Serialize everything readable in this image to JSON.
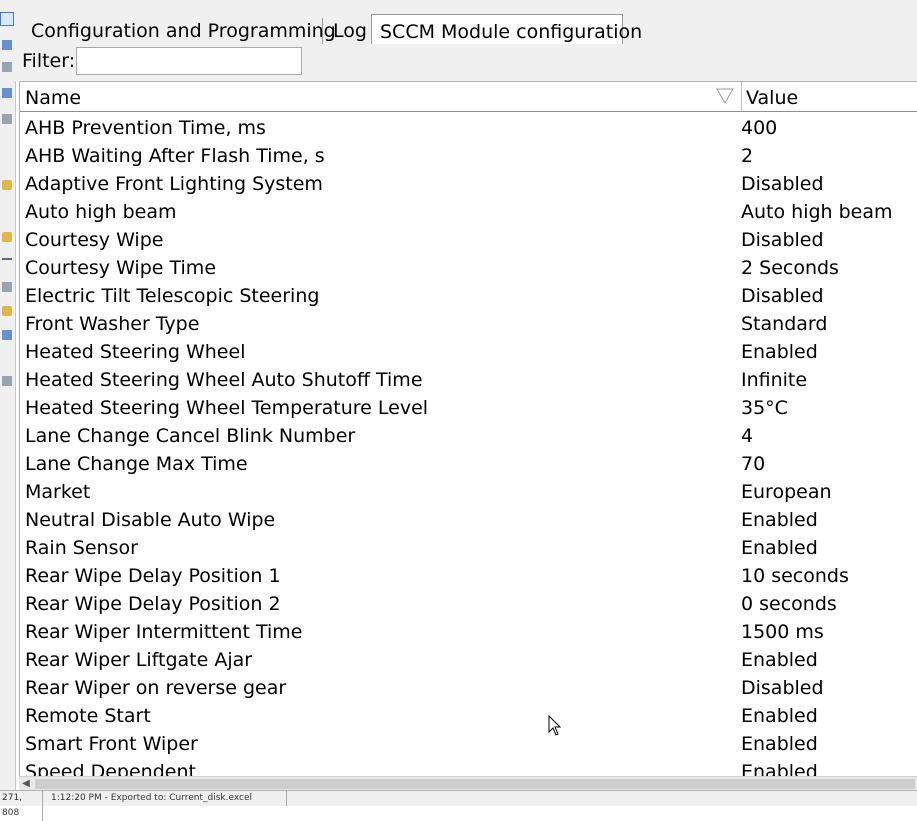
{
  "tabs": [
    {
      "label": "Configuration and Programming",
      "active": false
    },
    {
      "label": "Log",
      "active": false
    },
    {
      "label": "SCCM Module configuration",
      "active": true
    }
  ],
  "filter": {
    "label": "Filter:",
    "value": ""
  },
  "columns": {
    "name": "Name",
    "value": "Value"
  },
  "rows": [
    {
      "name": "AHB Prevention Time, ms",
      "value": "400"
    },
    {
      "name": "AHB Waiting After Flash Time, s",
      "value": "2"
    },
    {
      "name": "Adaptive Front Lighting System",
      "value": "Disabled"
    },
    {
      "name": "Auto high beam",
      "value": "Auto high beam"
    },
    {
      "name": "Courtesy Wipe",
      "value": "Disabled"
    },
    {
      "name": "Courtesy Wipe Time",
      "value": "2 Seconds"
    },
    {
      "name": "Electric Tilt Telescopic Steering",
      "value": "Disabled"
    },
    {
      "name": "Front Washer Type",
      "value": "Standard"
    },
    {
      "name": "Heated Steering Wheel",
      "value": "Enabled"
    },
    {
      "name": "Heated Steering Wheel Auto Shutoff Time",
      "value": "Infinite"
    },
    {
      "name": "Heated Steering Wheel Temperature Level",
      "value": "35°C"
    },
    {
      "name": "Lane Change Cancel Blink Number",
      "value": "4"
    },
    {
      "name": "Lane Change Max Time",
      "value": "70"
    },
    {
      "name": "Market",
      "value": "European"
    },
    {
      "name": "Neutral Disable Auto Wipe",
      "value": "Enabled"
    },
    {
      "name": "Rain Sensor",
      "value": "Enabled"
    },
    {
      "name": "Rear Wipe Delay Position 1",
      "value": "10 seconds"
    },
    {
      "name": "Rear Wipe Delay Position 2",
      "value": "0 seconds"
    },
    {
      "name": "Rear Wiper Intermittent Time",
      "value": "1500 ms"
    },
    {
      "name": "Rear Wiper Liftgate Ajar",
      "value": "Enabled"
    },
    {
      "name": "Rear Wiper on reverse gear",
      "value": "Disabled"
    },
    {
      "name": "Remote Start",
      "value": "Enabled"
    },
    {
      "name": "Smart Front Wiper",
      "value": "Enabled"
    },
    {
      "name": "Speed Dependent",
      "value": "Enabled"
    }
  ],
  "status": {
    "coords": "271, 808",
    "message": "1:12:20 PM - Exported to: Current_disk.excel"
  }
}
